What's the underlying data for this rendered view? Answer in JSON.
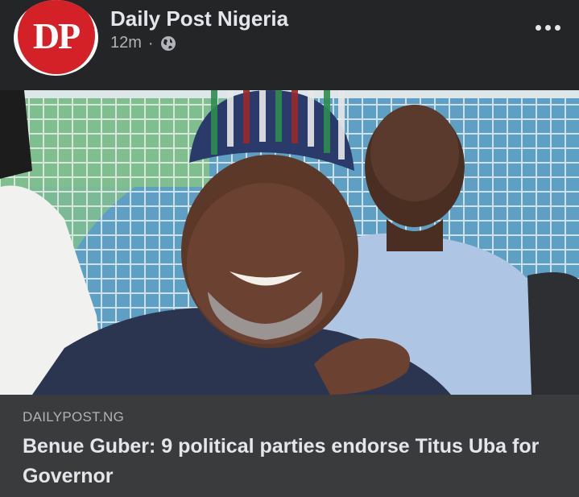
{
  "post": {
    "page_name": "Daily Post Nigeria",
    "avatar_text": "DP",
    "timestamp": "12m",
    "separator": "·",
    "privacy_icon": "globe-icon",
    "more_icon": "more-horizontal-icon"
  },
  "link": {
    "domain": "DAILYPOST.NG",
    "headline": "Benue Guber: 9 political parties endorse Titus Uba for Governor"
  },
  "colors": {
    "background": "#242526",
    "card": "#3a3b3c",
    "text_primary": "#e4e6eb",
    "text_secondary": "#b0b3b8",
    "brand_red": "#d42027"
  }
}
